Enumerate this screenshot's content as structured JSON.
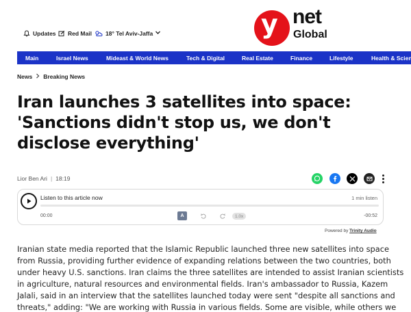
{
  "header": {
    "utilities": {
      "updates": "Updates",
      "red_mail": "Red Mail",
      "weather": "18° Tel Aviv-Jaffa"
    },
    "logo": {
      "mark": "y",
      "net": "net",
      "global": "Global",
      "brand_color": "#e4121a"
    }
  },
  "nav": {
    "bg_color": "#1b33c7",
    "items": [
      "Main",
      "Israel News",
      "Mideast & World News",
      "Tech & Digital",
      "Real Estate",
      "Finance",
      "Lifestyle",
      "Health & Scien"
    ]
  },
  "breadcrumb": {
    "items": [
      "News",
      "Breaking News"
    ]
  },
  "article": {
    "headline": "Iran launches 3 satellites into space: 'Sanctions didn't stop us, we don't disclose everything'",
    "author": "Lior Ben Ari",
    "time": "18:19",
    "body": "Iranian state media reported that the Islamic Republic launched three new satellites into space from Russia, providing further evidence of expanding relations between the two countries, both under heavy U.S. sanctions. Iran claims the three satellites are intended to assist Iranian scientists in agriculture, natural resources and environmental fields. Iran's ambassador to Russia, Kazem Jalali, said in an interview that the satellites launched today were sent \"despite all sanctions and threats,\" adding: \"We are working with Russia in various fields. Some are visible, while others we prefer not"
  },
  "share": {
    "icons": [
      "whatsapp-icon",
      "facebook-icon",
      "x-icon",
      "mail-icon",
      "more-icon"
    ]
  },
  "player": {
    "title": "Listen to this article now",
    "duration": "1 min listen",
    "time_start": "00:00",
    "time_end": "-00:52",
    "speed": "1.0x",
    "translate_label": "A",
    "powered_prefix": "Powered by",
    "powered_brand": "Trinity Audio"
  }
}
